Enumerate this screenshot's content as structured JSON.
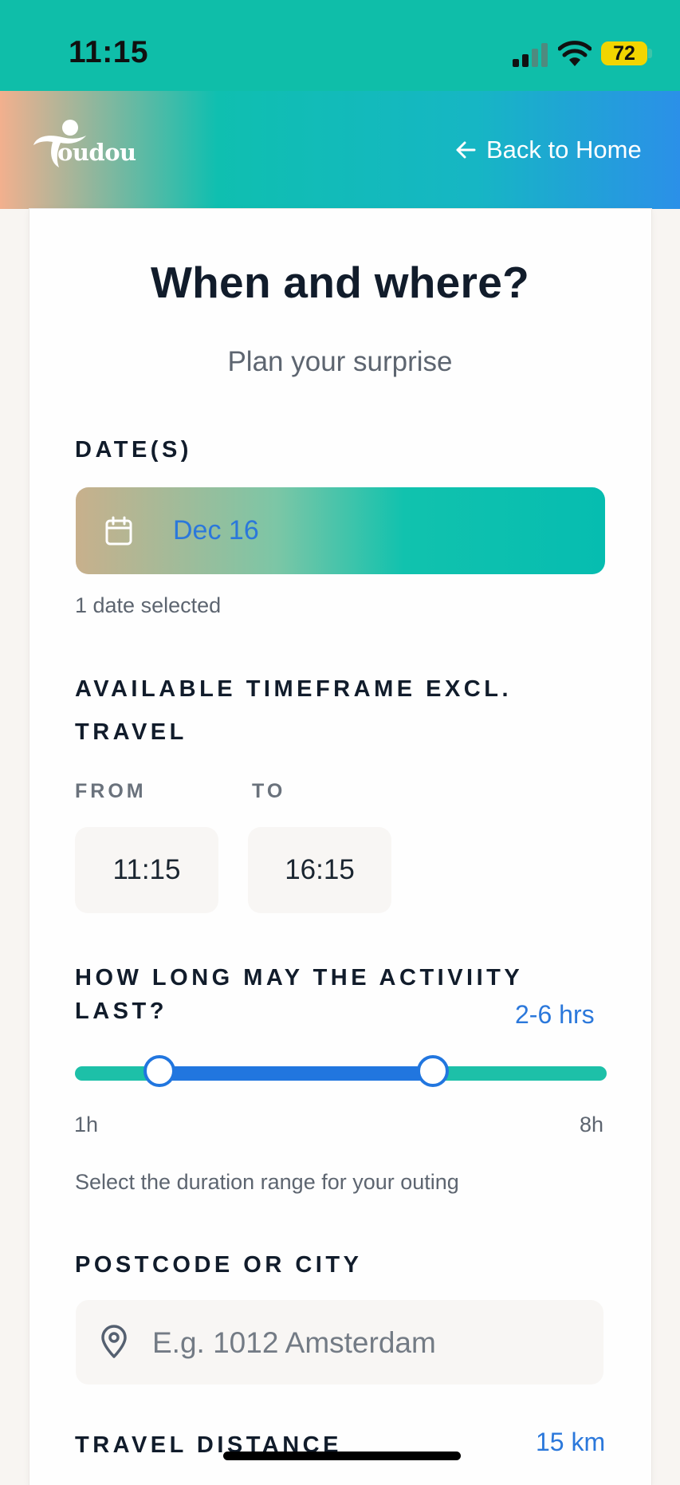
{
  "status_bar": {
    "time": "11:15",
    "battery": "72"
  },
  "header": {
    "logo_text": "oudou",
    "back_label": "Back to Home"
  },
  "page": {
    "title": "When and where?",
    "subtitle": "Plan your surprise"
  },
  "dates": {
    "label": "DATE(S)",
    "value": "Dec 16",
    "helper": "1 date selected"
  },
  "timeframe": {
    "label_line1": "AVAILABLE TIMEFRAME EXCL.",
    "label_line2": "TRAVEL",
    "from_label": "FROM",
    "from_value": "11:15",
    "to_label": "TO",
    "to_value": "16:15"
  },
  "duration": {
    "label_line1": "HOW LONG MAY THE ACTIVIITY",
    "label_line2": "LAST?",
    "range_text": "2-6 hrs",
    "min_label": "1h",
    "max_label": "8h",
    "min_hours": 1,
    "max_hours": 8,
    "selected_low": 2,
    "selected_high": 6,
    "helper": "Select the duration range for your outing"
  },
  "location": {
    "label": "POSTCODE OR CITY",
    "placeholder": "E.g. 1012 Amsterdam",
    "value": ""
  },
  "travel": {
    "label": "TRAVEL DISTANCE",
    "value": "15 km"
  },
  "icons": {
    "back": "arrow-left-icon",
    "calendar": "calendar-icon",
    "location": "map-pin-icon"
  },
  "colors": {
    "status_bar": "#0fbea9",
    "accent_blue": "#2b78db",
    "teal": "#1dc0a8",
    "battery": "#f2d500"
  }
}
